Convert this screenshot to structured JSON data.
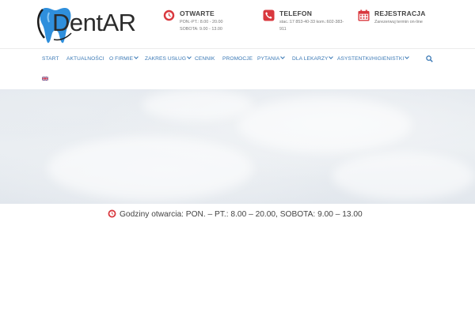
{
  "brand": {
    "logo_text": "DentAR"
  },
  "header": {
    "open": {
      "title": "OTWARTE",
      "line1": "PON.-PT.: 8.00 - 20.00",
      "line2": "SOBOTA: 9.00 - 13.00",
      "icon": "clock-icon"
    },
    "phone": {
      "title": "TELEFON",
      "line1": "stac.:17 853-40-33 kom.:602-383-",
      "line2": "911",
      "icon": "phone-icon"
    },
    "registration": {
      "title": "REJESTRACJA",
      "line1": "Zarezerwuj termin on-line",
      "icon": "calendar-icon"
    }
  },
  "nav": {
    "items": [
      {
        "label": "START",
        "dropdown": false
      },
      {
        "label": "AKTUALNOŚCI",
        "dropdown": false
      },
      {
        "label": "O FIRMIE",
        "dropdown": true
      },
      {
        "label": "ZAKRES USŁUG",
        "dropdown": true
      },
      {
        "label": "CENNIK",
        "dropdown": false
      },
      {
        "label": "PROMOCJE",
        "dropdown": false
      },
      {
        "label": "PYTANIA",
        "dropdown": true
      },
      {
        "label": "DLA LEKARZY",
        "dropdown": true
      },
      {
        "label": "ASYSTENTKI/HIGIENISTKI",
        "dropdown": true
      }
    ],
    "search_icon": "search-icon",
    "language_flag": "uk-flag-icon"
  },
  "hours_bar": {
    "text": "Godziny otwarcia: PON. – PT.: 8.00 – 20.00, SOBOTA: 9.00 – 13.00",
    "icon": "clock-icon"
  },
  "colors": {
    "accent_red": "#d9383e",
    "nav_blue": "#3a78b5",
    "logo_blue": "#2f8fdc"
  }
}
